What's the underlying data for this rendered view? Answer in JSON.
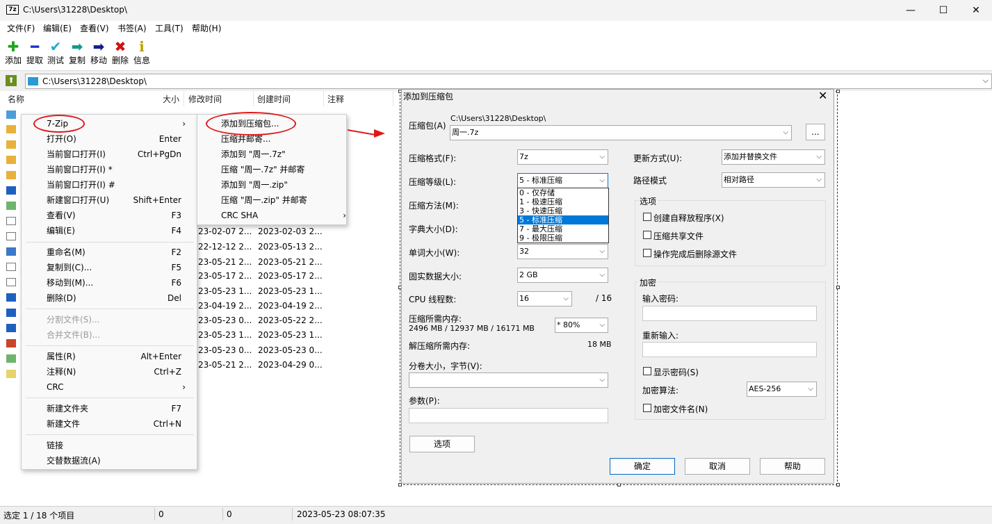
{
  "window": {
    "title": "C:\\Users\\31228\\Desktop\\",
    "app_icon": "7z",
    "min": "—",
    "max": "☐",
    "close": "✕"
  },
  "menu": [
    "文件(F)",
    "编辑(E)",
    "查看(V)",
    "书签(A)",
    "工具(T)",
    "帮助(H)"
  ],
  "toolbar": [
    {
      "label": "添加",
      "icon": "add-icon",
      "glyph": "✚",
      "color": "#1ea51e"
    },
    {
      "label": "提取",
      "icon": "extract-icon",
      "glyph": "━",
      "color": "#1a2fd0"
    },
    {
      "label": "测试",
      "icon": "test-icon",
      "glyph": "✔",
      "color": "#1ab0c8"
    },
    {
      "label": "复制",
      "icon": "copy-icon",
      "glyph": "➡",
      "color": "#119a8c"
    },
    {
      "label": "移动",
      "icon": "move-icon",
      "glyph": "➡",
      "color": "#1a1a8c"
    },
    {
      "label": "删除",
      "icon": "delete-icon",
      "glyph": "✖",
      "color": "#d01010"
    },
    {
      "label": "信息",
      "icon": "info-icon",
      "glyph": "ℹ",
      "color": "#b8a000"
    }
  ],
  "address": "C:\\Users\\31228\\Desktop\\",
  "columns": {
    "name": "名称",
    "size": "大小",
    "modified": "修改时间",
    "created": "创建时间",
    "comment": "注释"
  },
  "rows": [
    {
      "modified": "23-02-07 2...",
      "created": "2023-02-03 2..."
    },
    {
      "modified": "22-12-12 2...",
      "created": "2023-05-13 2..."
    },
    {
      "modified": "23-05-21 2...",
      "created": "2023-05-21 2..."
    },
    {
      "modified": "23-05-17 2...",
      "created": "2023-05-17 2..."
    },
    {
      "modified": "23-05-23 1...",
      "created": "2023-05-23 1..."
    },
    {
      "modified": "23-04-19 2...",
      "created": "2023-04-19 2..."
    },
    {
      "modified": "23-05-23 0...",
      "created": "2023-05-22 2..."
    },
    {
      "modified": "23-05-23 1...",
      "created": "2023-05-23 1..."
    },
    {
      "modified": "23-05-23 0...",
      "created": "2023-05-23 0..."
    },
    {
      "modified": "23-05-21 2...",
      "created": "2023-04-29 0..."
    }
  ],
  "context_menu": {
    "zip": "7-Zip",
    "open": "打开(O)",
    "open_key": "Enter",
    "open_inside": "当前窗口打开(I)",
    "open_inside_key": "Ctrl+PgDn",
    "open_inside_star": "当前窗口打开(I) *",
    "open_inside_hash": "当前窗口打开(I) #",
    "open_new": "新建窗口打开(U)",
    "open_new_key": "Shift+Enter",
    "view": "查看(V)",
    "view_key": "F3",
    "edit": "编辑(E)",
    "edit_key": "F4",
    "rename": "重命名(M)",
    "rename_key": "F2",
    "copy_to": "复制到(C)...",
    "copy_to_key": "F5",
    "move_to": "移动到(M)...",
    "move_to_key": "F6",
    "delete": "删除(D)",
    "delete_key": "Del",
    "split": "分割文件(S)...",
    "combine": "合并文件(B)...",
    "props": "属性(R)",
    "props_key": "Alt+Enter",
    "comment": "注释(N)",
    "comment_key": "Ctrl+Z",
    "crc": "CRC",
    "new_folder": "新建文件夹",
    "new_folder_key": "F7",
    "new_file": "新建文件",
    "new_file_key": "Ctrl+N",
    "link": "链接",
    "alt_streams": "交替数据流(A)"
  },
  "submenu": [
    "添加到压缩包...",
    "压缩并邮寄...",
    "添加到 \"周一.7z\"",
    "压缩 \"周一.7z\" 并邮寄",
    "添加到 \"周一.zip\"",
    "压缩 \"周一.zip\" 并邮寄",
    "CRC SHA"
  ],
  "dialog": {
    "title": "添加到压缩包",
    "archive_label": "压缩包(A)",
    "archive_path": "C:\\Users\\31228\\Desktop\\",
    "archive_name": "周一.7z",
    "browse": "...",
    "format_label": "压缩格式(F):",
    "format": "7z",
    "level_label": "压缩等级(L):",
    "level": "5 - 标准压缩",
    "method_label": "压缩方法(M):",
    "dict_label": "字典大小(D):",
    "word_label": "单词大小(W):",
    "word": "32",
    "solid_label": "固实数据大小:",
    "solid": "2 GB",
    "cpu_label": "CPU 线程数:",
    "cpu": "16",
    "cpu_total": "/ 16",
    "mem_label": "压缩所需内存:",
    "mem_values": "2496 MB / 12937 MB / 16171 MB",
    "mem_pct": "* 80%",
    "decomp_label": "解压缩所需内存:",
    "decomp": "18 MB",
    "split_label": "分卷大小，字节(V):",
    "params_label": "参数(P):",
    "options_btn": "选项",
    "update_label": "更新方式(U):",
    "update": "添加并替换文件",
    "path_label": "路径模式",
    "path": "相对路径",
    "options_group": "选项",
    "opt_sfx": "创建自释放程序(X)",
    "opt_shared": "压缩共享文件",
    "opt_delete": "操作完成后删除源文件",
    "enc_group": "加密",
    "pwd_label": "输入密码:",
    "repwd_label": "重新输入:",
    "show_pwd": "显示密码(S)",
    "enc_method_label": "加密算法:",
    "enc_method": "AES-256",
    "enc_names": "加密文件名(N)",
    "ok": "确定",
    "cancel": "取消",
    "help": "帮助",
    "levels": [
      "0 - 仅存储",
      "1 - 极速压缩",
      "3 - 快速压缩",
      "5 - 标准压缩",
      "7 - 最大压缩",
      "9 - 极限压缩"
    ]
  },
  "status": {
    "selection": "选定 1 / 18 个项目",
    "size": "0",
    "packed": "0",
    "date": "2023-05-23 08:07:35"
  },
  "colors": {
    "annotation": "#e01818",
    "highlight": "#0078d7"
  }
}
